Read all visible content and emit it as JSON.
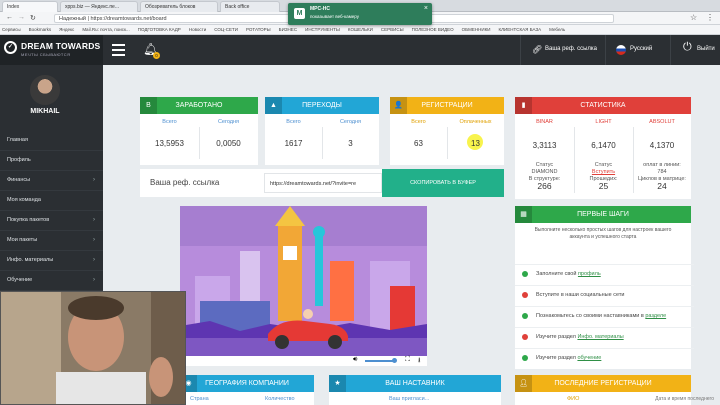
{
  "browser": {
    "tabs": [
      "Index",
      "xpps.biz — Яндекс.пе...",
      "Обозреватель блоков",
      "Back office"
    ],
    "address": "Надежный | https://dreamtowards.net/board",
    "bookmarks": [
      "Сервисы",
      "Bookmarks",
      "Яндекс",
      "Mail.Ru: почта, поиск...",
      "ПОДГОТОВКА КАДР",
      "Новости",
      "СОЦ-СЕТИ",
      "РОТАТОРЫ",
      "БИЗНЕС",
      "ИНСТРУМЕНТЫ",
      "КОШЕЛЬКИ",
      "СЕРВИСЫ",
      "ПОЛЕЗНОЕ ВИДЕО",
      "ОБМЕННИКИ",
      "КЛИЕНТСКАЯ БАЗА",
      "Мебель"
    ],
    "notification": {
      "title": "MPC-HC",
      "text": "показывает веб-камеру"
    }
  },
  "header": {
    "logo_title": "DREAM TOWARDS",
    "logo_tagline": "МЕЧТЫ СБЫВАЮТСЯ",
    "ref_link_label": "Ваша реф. ссылка",
    "language": "Русский",
    "logout_label": "Выйти",
    "bell_badge": "0"
  },
  "sidebar": {
    "username": "MIKHAIL",
    "items": [
      "Главная",
      "Профиль",
      "Финансы",
      "Моя команда",
      "Покупка пакетов",
      "Мои пакеты",
      "Инфо. материалы",
      "Обучение"
    ],
    "has_submenu": [
      false,
      false,
      true,
      false,
      true,
      true,
      true,
      true
    ]
  },
  "cards": {
    "earned": {
      "title": "ЗАРАБОТАНО",
      "icon": "B",
      "col1": "Всего",
      "col2": "Сегодня",
      "val1": "13,5953",
      "val2": "0,0050",
      "color": "#2ea84a"
    },
    "clicks": {
      "title": "ПЕРЕХОДЫ",
      "icon": "▲",
      "col1": "Всего",
      "col2": "Сегодня",
      "val1": "1617",
      "val2": "3",
      "color": "#22a6d6"
    },
    "regs": {
      "title": "РЕГИСТРАЦИИ",
      "icon": "👤",
      "col1": "Всего",
      "col2": "Оплаченных",
      "val1": "63",
      "val2": "13",
      "color": "#f2b216"
    },
    "stats": {
      "title": "СТАТИСТИКА",
      "icon": "▮",
      "color": "#e0403a",
      "headers": [
        "BINAR",
        "LIGHT",
        "ABSOLUT"
      ],
      "values": [
        "3,3113",
        "6,1470",
        "4,1370"
      ],
      "status_label": "Статус",
      "status1": "DIAMOND",
      "status2": "Вступить",
      "paid_label": "оплат в линии:",
      "paid_value": "784",
      "in_structure_label": "В структуре:",
      "in_structure": "266",
      "partners_label": "Прошедих:",
      "partners": "25",
      "cycles_label": "Циклов в матрице:",
      "cycles": "24"
    }
  },
  "ref": {
    "label": "Ваша реф. ссылка",
    "url": "https://dreamtowards.net/?invite=re",
    "copy_button": "СКОПИРОВАТЬ В БУФЕР"
  },
  "first_steps": {
    "title": "ПЕРВЫЕ ШАГИ",
    "intro": "Выполните несколько простых шагов для настроек вашего аккаунта и успешного старта",
    "items": [
      {
        "pre": "Заполните свой ",
        "link": "профиль",
        "post": "",
        "done": true
      },
      {
        "pre": "Вступите в наши социальные сети",
        "link": "",
        "post": "",
        "done": false
      },
      {
        "pre": "Познакомьтесь со своими наставниками в ",
        "link": "разделе",
        "post": "",
        "done": true
      },
      {
        "pre": "Изучите раздел ",
        "link": "Инфо. материалы",
        "post": "",
        "done": false
      },
      {
        "pre": "Изучите раздел ",
        "link": "обучение",
        "post": "",
        "done": true
      }
    ]
  },
  "bottom": {
    "geo": {
      "title": "ГЕОГРАФИЯ КОМПАНИИ",
      "col1": "Страна",
      "col2": "Количество"
    },
    "mentor": {
      "title": "ВАШ НАСТАВНИК",
      "sub": "Ваш пригласи..."
    },
    "recent": {
      "title": "ПОСЛЕДНИЕ РЕГИСТРАЦИИ",
      "sub": "ФИО"
    }
  },
  "video": {
    "progress": 0.0
  },
  "watermark": "Дата и время последнего"
}
